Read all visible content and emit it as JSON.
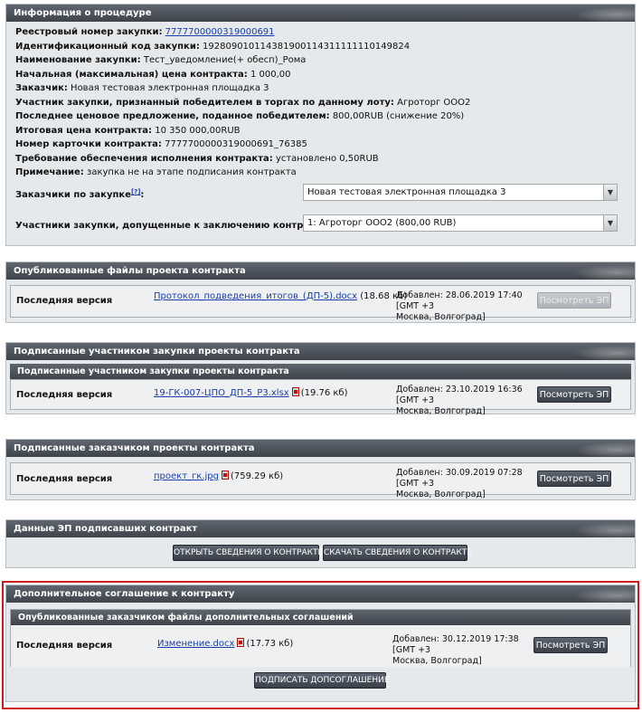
{
  "info": {
    "title": "Информация о процедуре",
    "lines": [
      {
        "label": "Реестровый номер закупки:",
        "value": "7777700000319000691"
      },
      {
        "label": "Идентификационный код закупки:",
        "value": "192809010114381900114311111110149824"
      },
      {
        "label": "Наименование закупки:",
        "value": "Тест_уведомление(+ обесп)_Рома"
      },
      {
        "label": "Начальная (максимальная) цена контракта:",
        "value": "1 000,00"
      },
      {
        "label": "Заказчик:",
        "value": "Новая тестовая электронная площадка 3"
      },
      {
        "label": "Участник закупки, признанный победителем в торгах по данному лоту:",
        "value": "Агроторг ООО2"
      },
      {
        "label": "Последнее ценовое предложение, поданное победителем:",
        "value": "800,00RUB (снижение 20%)"
      },
      {
        "label": "Итоговая цена контракта:",
        "value": "10 350 000,00RUB"
      },
      {
        "label": "Номер карточки контракта:",
        "value": "7777700000319000691_76385"
      },
      {
        "label": "Требование обеспечения исполнения контракта:",
        "value": "установлено 0,50RUB"
      },
      {
        "label": "Примечание:",
        "value": "закупка не на этапе подписания контракта"
      }
    ],
    "customers_label": "Заказчики по закупке",
    "customers_help": "[?]",
    "customers_colon": ":",
    "customers_value": "Новая тестовая электронная площадка 3",
    "participants_label": "Участники закупки, допущенные к заключению контракта",
    "participants_help": "[?]",
    "participants_colon": ":",
    "participants_value": "1: Агроторг ООО2 (800,00 RUB)"
  },
  "published": {
    "title": "Опубликованные файлы проекта контракта",
    "label": "Последняя версия",
    "file": "Протокол_подведения_итогов_(ДП-5).docx",
    "size": "(18.68 кб)",
    "date1": "Добавлен: 28.06.2019 17:40 [GMT +3",
    "date2": "Москва, Волгоград]",
    "button": "Посмотреть ЭП"
  },
  "signed_participant": {
    "title": "Подписанные участником закупки проекты контракта",
    "subtitle": "Подписанные участником закупки проекты контракта",
    "label": "Последняя версия",
    "file": "19-ГК-007-ЦПО_ДП-5_Р3.xlsx",
    "size": "(19.76 кб)",
    "date1": "Добавлен: 23.10.2019 16:36 [GMT +3",
    "date2": "Москва, Волгоград]",
    "button": "Посмотреть ЭП"
  },
  "signed_customer": {
    "title": "Подписанные заказчиком проекты контракта",
    "label": "Последняя версия",
    "file": "проект_гк.jpg",
    "size": "(759.29 кб)",
    "date1": "Добавлен: 30.09.2019 07:28 [GMT +3",
    "date2": "Москва, Волгоград]",
    "button": "Посмотреть ЭП"
  },
  "ep": {
    "title": "Данные ЭП подписавших контракт",
    "open_button": "Открыть сведения о контракте",
    "download_button": "Скачать сведения о контракте"
  },
  "addendum": {
    "title": "Дополнительное соглашение к контракту",
    "subtitle": "Опубликованные заказчиком файлы дополнительных соглашений",
    "label": "Последняя версия",
    "file": "Изменение.docx",
    "size": "(17.73 кб)",
    "date1": "Добавлен: 30.12.2019 17:38 [GMT +3",
    "date2": "Москва, Волгоград]",
    "button": "Посмотреть ЭП",
    "sign_button": "Подписать допсоглашение"
  }
}
